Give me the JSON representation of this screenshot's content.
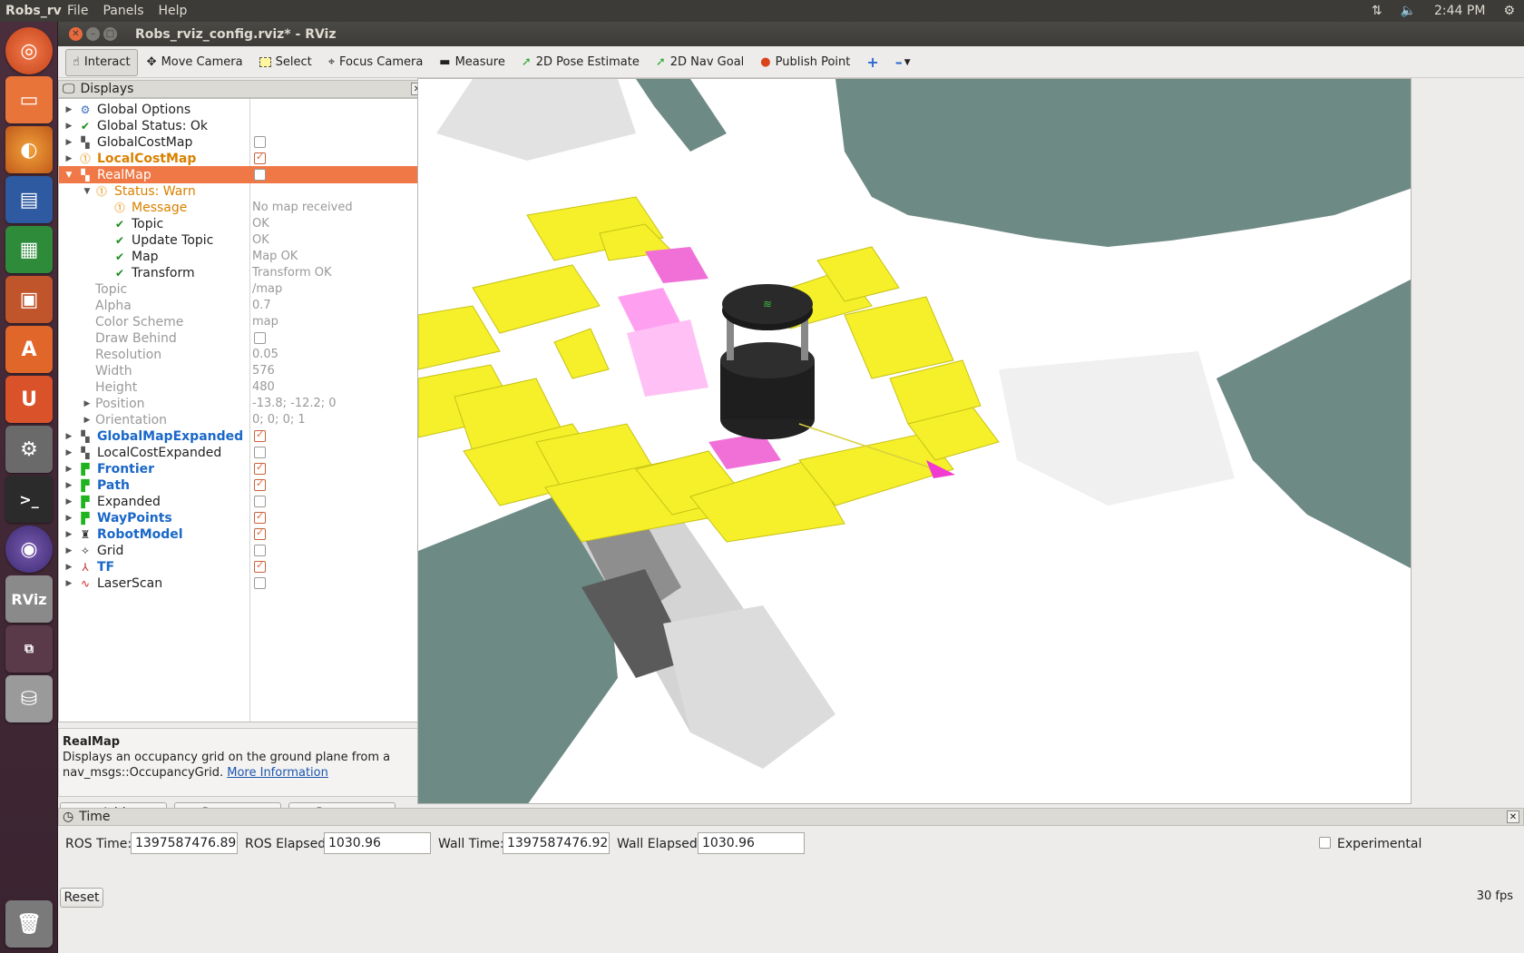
{
  "topbar": {
    "app_name": "Robs_rv",
    "menus": [
      "File",
      "Panels",
      "Help"
    ],
    "clock": "2:44 PM"
  },
  "window": {
    "title": "Robs_rviz_config.rviz* - RViz"
  },
  "toolbar": {
    "interact": "Interact",
    "move_camera": "Move Camera",
    "select": "Select",
    "focus_camera": "Focus Camera",
    "measure": "Measure",
    "pose_estimate": "2D Pose Estimate",
    "nav_goal": "2D Nav Goal",
    "publish_point": "Publish Point"
  },
  "displays": {
    "header": "Displays",
    "rows": [
      {
        "label": "Global Options"
      },
      {
        "label": "Global Status: Ok"
      },
      {
        "label": "GlobalCostMap"
      },
      {
        "label": "LocalCostMap"
      },
      {
        "label": "RealMap"
      },
      {
        "label": "Status: Warn"
      },
      {
        "label": "Message",
        "value": "No map received"
      },
      {
        "label": "Topic",
        "value": "OK"
      },
      {
        "label": "Update Topic",
        "value": "OK"
      },
      {
        "label": "Map",
        "value": "Map OK"
      },
      {
        "label": "Transform",
        "value": "Transform OK"
      },
      {
        "label": "Topic",
        "value": "/map"
      },
      {
        "label": "Alpha",
        "value": "0.7"
      },
      {
        "label": "Color Scheme",
        "value": "map"
      },
      {
        "label": "Draw Behind"
      },
      {
        "label": "Resolution",
        "value": "0.05"
      },
      {
        "label": "Width",
        "value": "576"
      },
      {
        "label": "Height",
        "value": "480"
      },
      {
        "label": "Position",
        "value": "-13.8; -12.2; 0"
      },
      {
        "label": "Orientation",
        "value": "0; 0; 0; 1"
      },
      {
        "label": "GlobalMapExpanded"
      },
      {
        "label": "LocalCostExpanded"
      },
      {
        "label": "Frontier"
      },
      {
        "label": "Path"
      },
      {
        "label": "Expanded"
      },
      {
        "label": "WayPoints"
      },
      {
        "label": "RobotModel"
      },
      {
        "label": "Grid"
      },
      {
        "label": "TF"
      },
      {
        "label": "LaserScan"
      }
    ]
  },
  "description": {
    "title": "RealMap",
    "text": "Displays an occupancy grid on the ground plane from a nav_msgs::OccupancyGrid.",
    "link": "More Information"
  },
  "panel_buttons": {
    "add": "Add",
    "remove": "Remove",
    "rename": "Rename"
  },
  "time": {
    "header": "Time",
    "ros_time_label": "ROS Time:",
    "ros_time": "1397587476.89",
    "ros_elapsed_label": "ROS Elapsed:",
    "ros_elapsed": "1030.96",
    "wall_time_label": "Wall Time:",
    "wall_time": "1397587476.92",
    "wall_elapsed_label": "Wall Elapsed:",
    "wall_elapsed": "1030.96",
    "experimental": "Experimental",
    "reset": "Reset",
    "fps": "30 fps"
  },
  "colors": {
    "accent": "#f07746",
    "yellow": "#f5f02a",
    "magenta": "#f050c8",
    "occupied": "#6e8a84"
  }
}
